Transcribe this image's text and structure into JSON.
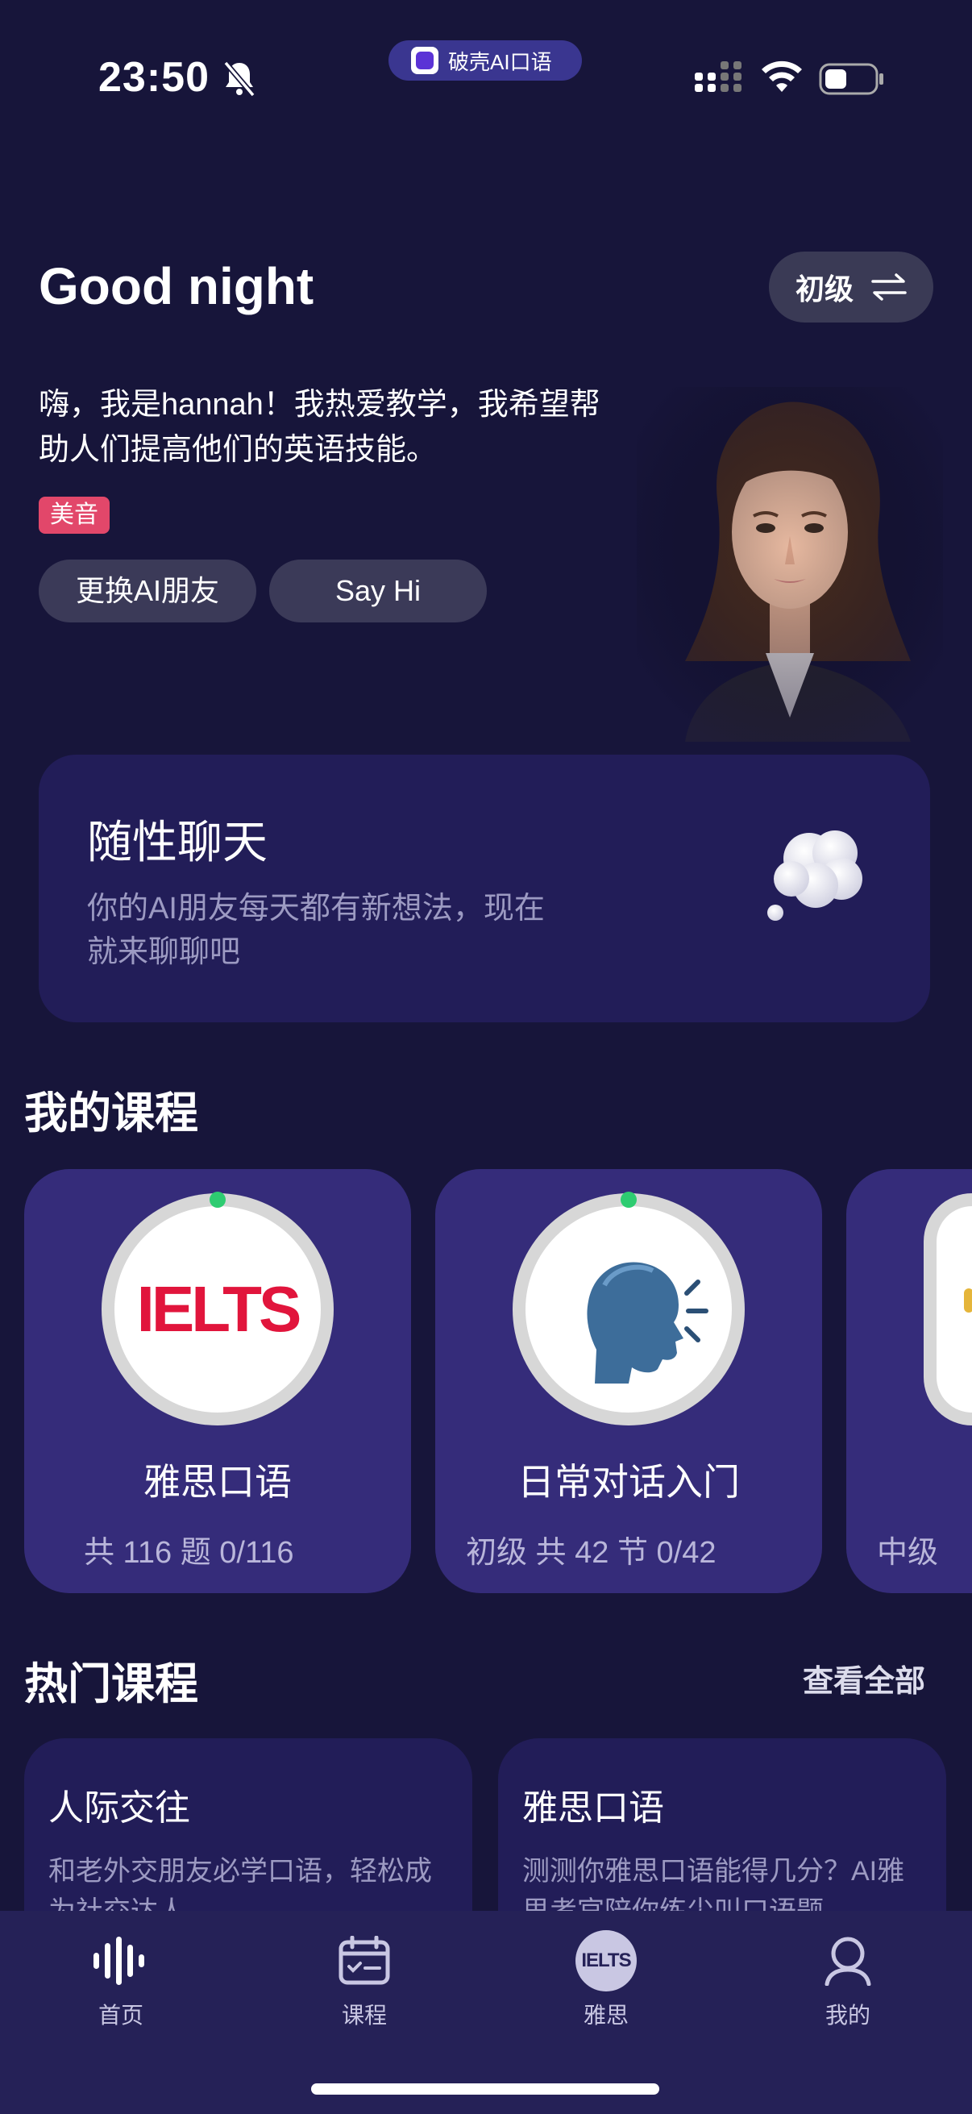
{
  "status_bar": {
    "time": "23:50",
    "app_pill_label": "破壳AI口语"
  },
  "header": {
    "greeting": "Good night",
    "level_label": "初级"
  },
  "tutor": {
    "intro": "嗨，我是hannah！我热爱教学，我希望帮助人们提高他们的英语技能。",
    "accent_tag": "美音",
    "change_button": "更换AI朋友",
    "say_hi_button": "Say Hi"
  },
  "chat_card": {
    "title": "随性聊天",
    "description": "你的AI朋友每天都有新想法，现在就来聊聊吧"
  },
  "my_courses": {
    "title": "我的课程",
    "items": [
      {
        "name": "雅思口语",
        "meta": "共 116 题   0/116",
        "icon": "ielts-logo",
        "logo_text": "IELTS"
      },
      {
        "name": "日常对话入门",
        "meta": "初级   共 42 节   0/42",
        "icon": "speaking-head-icon"
      },
      {
        "name": "",
        "meta": "中级",
        "icon": "partial-icon"
      }
    ]
  },
  "hot_courses": {
    "title": "热门课程",
    "view_all": "查看全部",
    "items": [
      {
        "title": "人际交往",
        "description": "和老外交朋友必学口语，轻松成为社交达人"
      },
      {
        "title": "雅思口语",
        "description": "测测你雅思口语能得几分？AI雅思考官陪你练尖叫口语题"
      }
    ]
  },
  "tab_bar": {
    "tabs": [
      {
        "label": "首页",
        "icon": "waveform-icon"
      },
      {
        "label": "课程",
        "icon": "calendar-check-icon"
      },
      {
        "label": "雅思",
        "icon": "ielts-badge-icon",
        "badge_text": "IELTS"
      },
      {
        "label": "我的",
        "icon": "user-icon"
      }
    ]
  },
  "colors": {
    "background": "#17153a",
    "card": "#221d58",
    "course_card": "#352c7a",
    "tag": "#e2476a",
    "progress_dot": "#2ecc71"
  }
}
